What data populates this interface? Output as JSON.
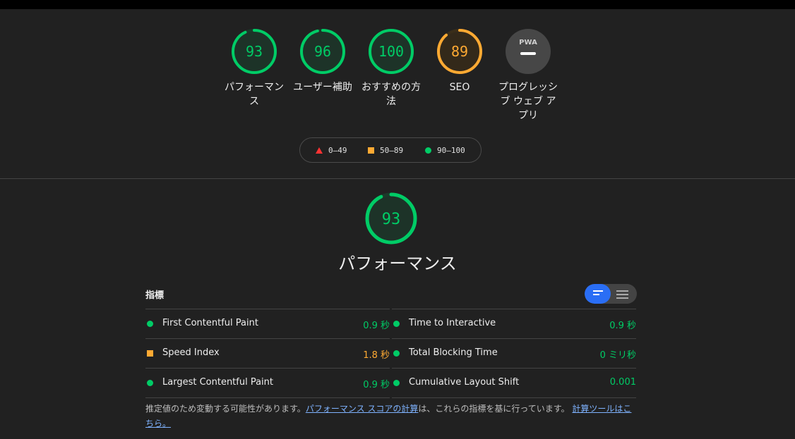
{
  "categories": [
    {
      "id": "performance",
      "score": "93",
      "label": "パフォーマンス",
      "status": "pass",
      "fraction": 0.93
    },
    {
      "id": "accessibility",
      "score": "96",
      "label": "ユーザー補助",
      "status": "pass",
      "fraction": 0.96
    },
    {
      "id": "best-practices",
      "score": "100",
      "label": "おすすめの方法",
      "status": "pass",
      "fraction": 1.0
    },
    {
      "id": "seo",
      "score": "89",
      "label": "SEO",
      "status": "average",
      "fraction": 0.89
    },
    {
      "id": "pwa",
      "badge": "PWA",
      "label": "プログレッシブ ウェブ アプリ",
      "status": "na"
    }
  ],
  "legend": {
    "fail": "0–49",
    "average": "50–89",
    "pass": "90–100"
  },
  "performance": {
    "score": "93",
    "fraction": 0.93,
    "title": "パフォーマンス"
  },
  "metrics": {
    "title": "指標",
    "left": [
      {
        "name": "First Contentful Paint",
        "value": "0.9 秒",
        "status": "pass"
      },
      {
        "name": "Speed Index",
        "value": "1.8 秒",
        "status": "average"
      },
      {
        "name": "Largest Contentful Paint",
        "value": "0.9 秒",
        "status": "pass"
      }
    ],
    "right": [
      {
        "name": "Time to Interactive",
        "value": "0.9 秒",
        "status": "pass"
      },
      {
        "name": "Total Blocking Time",
        "value": "0 ミリ秒",
        "status": "pass"
      },
      {
        "name": "Cumulative Layout Shift",
        "value": "0.001",
        "status": "pass"
      }
    ]
  },
  "note": {
    "text1": "推定値のため変動する可能性があります。",
    "link1": "パフォーマンス スコアの計算",
    "text2": "は、これらの指標を基に行っています。",
    "link2": "計算ツールはこちら。"
  },
  "colors": {
    "pass": "#00cc66",
    "average": "#ffaa33",
    "fail": "#ff3333",
    "background": "#212121"
  }
}
